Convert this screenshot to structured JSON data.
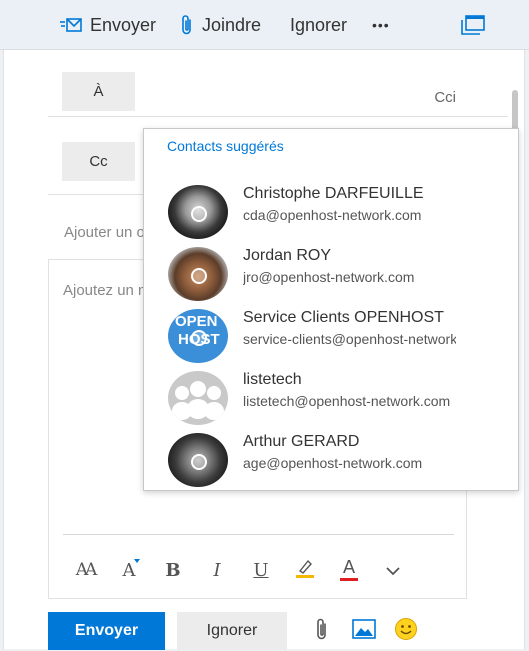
{
  "toolbar": {
    "send_label": "Envoyer",
    "attach_label": "Joindre",
    "discard_label": "Ignorer",
    "more_label": "•••",
    "popout_icon": "popout-window-icon"
  },
  "recipients": {
    "to_label": "À",
    "cc_label": "Cc",
    "bcc_label": "Cci"
  },
  "subject": {
    "placeholder": "Ajouter un o"
  },
  "body": {
    "placeholder": "Ajoutez un m"
  },
  "format_bar": {
    "font_size_label": "AA",
    "font_grow_label": "A",
    "bold_label": "B",
    "italic_label": "I",
    "underline_label": "U",
    "font_color_label": "A",
    "highlight_color": "#f5b800",
    "font_color": "#e02020"
  },
  "actions": {
    "send_label": "Envoyer",
    "discard_label": "Ignorer"
  },
  "suggestions": {
    "title": "Contacts suggérés",
    "contacts": [
      {
        "name": "Christophe DARFEUILLE",
        "email": "cda@openhost-network.com"
      },
      {
        "name": "Jordan ROY",
        "email": "jro@openhost-network.com"
      },
      {
        "name": "Service Clients OPENHOST",
        "email": "service-clients@openhost-network.com"
      },
      {
        "name": "listetech",
        "email": "listetech@openhost-network.com"
      },
      {
        "name": "Arthur GERARD",
        "email": "age@openhost-network.com"
      }
    ],
    "service_logo_text": [
      "OPEN",
      "HOST"
    ]
  },
  "colors": {
    "accent": "#0078d7",
    "toolbar_bg": "#eaf0f6"
  }
}
